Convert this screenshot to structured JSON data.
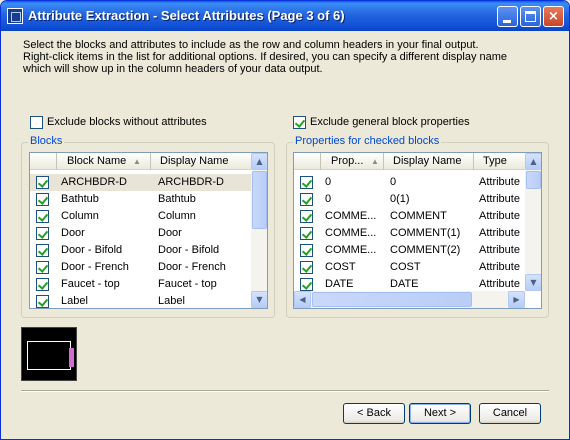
{
  "window": {
    "title": "Attribute Extraction - Select Attributes (Page 3 of 6)"
  },
  "titlebar_buttons": {
    "minimize": "minimize",
    "maximize": "maximize",
    "close": "×"
  },
  "instructions": [
    "Select the blocks and attributes to include as the row and column headers in your final output.",
    "Right-click items in the list for additional options. If desired, you can specify a different display name",
    "which will show up in the column headers of your data output."
  ],
  "options": {
    "exclude_blocks_without_attributes": {
      "label": "Exclude blocks without attributes",
      "checked": false
    },
    "exclude_general_block_properties": {
      "label": "Exclude general block properties",
      "checked": true
    }
  },
  "blocks": {
    "group_label": "Blocks",
    "columns": [
      "Block Name",
      "Display Name"
    ],
    "sort_indicator": "▲",
    "rows": [
      {
        "name": "ARCHBDR-D",
        "display": "ARCHBDR-D",
        "checked": true
      },
      {
        "name": "Bathtub",
        "display": "Bathtub",
        "checked": true
      },
      {
        "name": "Column",
        "display": "Column",
        "checked": true
      },
      {
        "name": "Door",
        "display": "Door",
        "checked": true
      },
      {
        "name": "Door - Bifold",
        "display": "Door - Bifold",
        "checked": true
      },
      {
        "name": "Door - French",
        "display": "Door - French",
        "checked": true
      },
      {
        "name": "Faucet - top",
        "display": "Faucet - top",
        "checked": true
      },
      {
        "name": "Label",
        "display": "Label",
        "checked": true
      }
    ]
  },
  "properties": {
    "group_label": "Properties for checked blocks",
    "columns": [
      "Prop...",
      "Display Name",
      "Type"
    ],
    "sort_indicator": "▲",
    "rows": [
      {
        "prop": "0",
        "display": "0",
        "type": "Attribute",
        "checked": true
      },
      {
        "prop": "0",
        "display": "0(1)",
        "type": "Attribute",
        "checked": true
      },
      {
        "prop": "COMME...",
        "display": "COMMENT",
        "type": "Attribute",
        "checked": true
      },
      {
        "prop": "COMME...",
        "display": "COMMENT(1)",
        "type": "Attribute",
        "checked": true
      },
      {
        "prop": "COMME...",
        "display": "COMMENT(2)",
        "type": "Attribute",
        "checked": true
      },
      {
        "prop": "COST",
        "display": "COST",
        "type": "Attribute",
        "checked": true
      },
      {
        "prop": "DATE",
        "display": "DATE",
        "type": "Attribute",
        "checked": true
      }
    ]
  },
  "scroll_arrows": {
    "up": "▲",
    "down": "▼",
    "left": "◀",
    "right": "▶"
  },
  "buttons": {
    "back": "< Back",
    "next": "Next >",
    "cancel": "Cancel"
  },
  "colors": {
    "titlebar": "#0a43c4",
    "group_label": "#0046d5",
    "check": "#21a121",
    "dialog_bg": "#ece9d8"
  }
}
